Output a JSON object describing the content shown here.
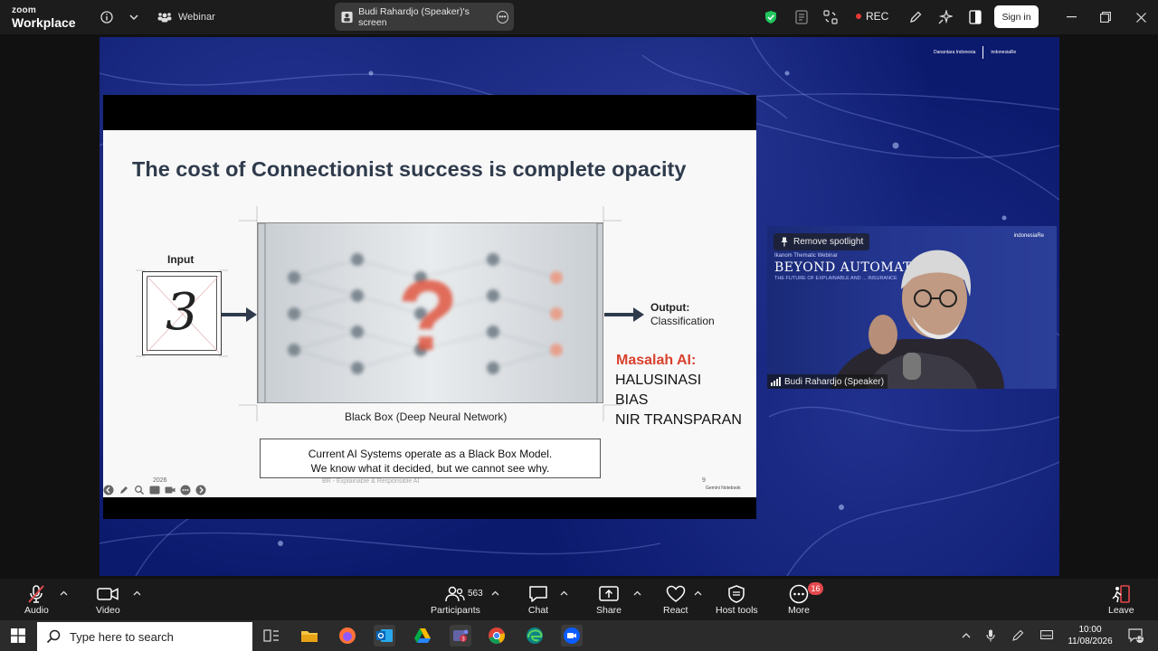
{
  "app": {
    "brand_line1": "zoom",
    "brand_line2": "Workplace",
    "webinar_label": "Webinar"
  },
  "share_indicator": {
    "label": "Budi Rahardjo (Speaker)'s screen"
  },
  "topbar": {
    "rec_label": "REC",
    "signin_label": "Sign in"
  },
  "shared_banner": {
    "logo1": "Danantara Indonesia",
    "logo2": "indonesiaRe"
  },
  "slide": {
    "title": "The cost of Connectionist success is complete opacity",
    "input_label": "Input",
    "input_digit": "3",
    "black_box_caption": "Black Box (Deep Neural Network)",
    "output_label": "Output:",
    "output_sub": "Classification",
    "masalah_heading": "Masalah AI:",
    "masalah_items": [
      "HALUSINASI",
      "BIAS",
      "NIR TRANSPARAN"
    ],
    "caption_line1": "Current AI Systems operate as a Black Box Model.",
    "caption_line2": "We know what it decided, but we cannot see why.",
    "footer_left": "BR - Explainable & Responsible AI",
    "year": "2026",
    "page_no": "9",
    "gemini": "Gemini Notebook"
  },
  "speaker": {
    "spotlight_label": "Remove spotlight",
    "logo": "indonesiaRe",
    "small": "Ikanom Thematic Webinar",
    "title": "BEYOND AUTOMAT",
    "subtitle": "THE FUTURE OF EXPLAINABLE AND ... INSURANCE",
    "name": "Budi Rahardjo (Speaker)"
  },
  "toolbar": {
    "audio": "Audio",
    "video": "Video",
    "participants": "Participants",
    "participants_count": "563",
    "chat": "Chat",
    "share": "Share",
    "react": "React",
    "host_tools": "Host tools",
    "more": "More",
    "more_badge": "16",
    "leave": "Leave"
  },
  "taskbar": {
    "search_placeholder": "Type here to search",
    "time": "10:00",
    "date": "11/08/2026",
    "notif_count": "12"
  },
  "colors": {
    "accent_red": "#e5484d",
    "slide_title": "#2f3b4c",
    "masalah_red": "#d9412e",
    "share_bg": "#0c1a6e"
  }
}
